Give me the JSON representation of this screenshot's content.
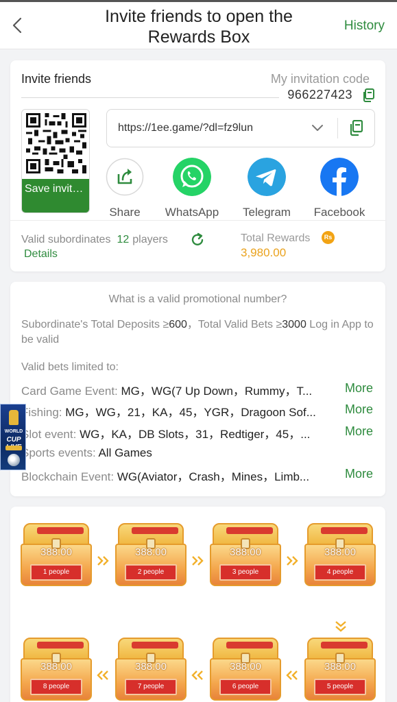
{
  "header": {
    "title": "Invite friends to open the Rewards Box",
    "history_label": "History"
  },
  "invite": {
    "label": "Invite friends",
    "code_label": "My invitation code",
    "code": "966227423",
    "save_label": "Save invitation...",
    "link": "https://1ee.game/?dl=fz9lun",
    "share": [
      {
        "label": "Share",
        "icon": "share-icon"
      },
      {
        "label": "WhatsApp",
        "icon": "whatsapp-icon"
      },
      {
        "label": "Telegram",
        "icon": "telegram-icon"
      },
      {
        "label": "Facebook",
        "icon": "facebook-icon"
      }
    ],
    "valid_label": "Valid subordinates",
    "valid_count": "12",
    "valid_unit": "players",
    "details_label": "Details",
    "total_label": "Total Rewards",
    "currency_badge": "Rs",
    "total_value": "3,980.00"
  },
  "promo": {
    "question": "What is a valid promotional number?",
    "rule_deposit_label": "Subordinate's Total Deposits ≥",
    "rule_deposit_value": "600",
    "rule_bets_label": "，Total Valid Bets ≥",
    "rule_bets_value": "3000",
    "rule_tail": " Log in App to be valid",
    "limit_label": "Valid bets limited to:",
    "more_label": "More",
    "rows": [
      {
        "category": "Card Game Event: ",
        "value": "MG，WG(7 Up Down，Rummy，T..."
      },
      {
        "category": "Fishing: ",
        "value": "MG，WG，21，KA，45，YGR，Dragoon Sof..."
      },
      {
        "category": "Slot event: ",
        "value": "WG，KA，DB Slots，31，Redtiger，45，..."
      },
      {
        "category": "Sports events: ",
        "value": "All Games"
      },
      {
        "category": "Blockchain Event: ",
        "value": "WG(Aviator，Crash，Mines，Limb..."
      }
    ]
  },
  "float_ad": {
    "line1": "WORLD",
    "line2": "CUP",
    "line3": "LIVE"
  },
  "chests": [
    {
      "amount": "388.00",
      "people": "1 people"
    },
    {
      "amount": "388.00",
      "people": "2 people"
    },
    {
      "amount": "388.00",
      "people": "3 people"
    },
    {
      "amount": "388.00",
      "people": "4 people"
    },
    {
      "amount": "388.00",
      "people": "5 people"
    },
    {
      "amount": "388.00",
      "people": "6 people"
    },
    {
      "amount": "388.00",
      "people": "7 people"
    },
    {
      "amount": "388.00",
      "people": "8 people"
    }
  ],
  "colors": {
    "accent_green": "#2e8b3e",
    "reward_gold": "#eaa21d",
    "whatsapp": "#25d366",
    "telegram": "#2aa3e0",
    "facebook": "#1877f2"
  }
}
